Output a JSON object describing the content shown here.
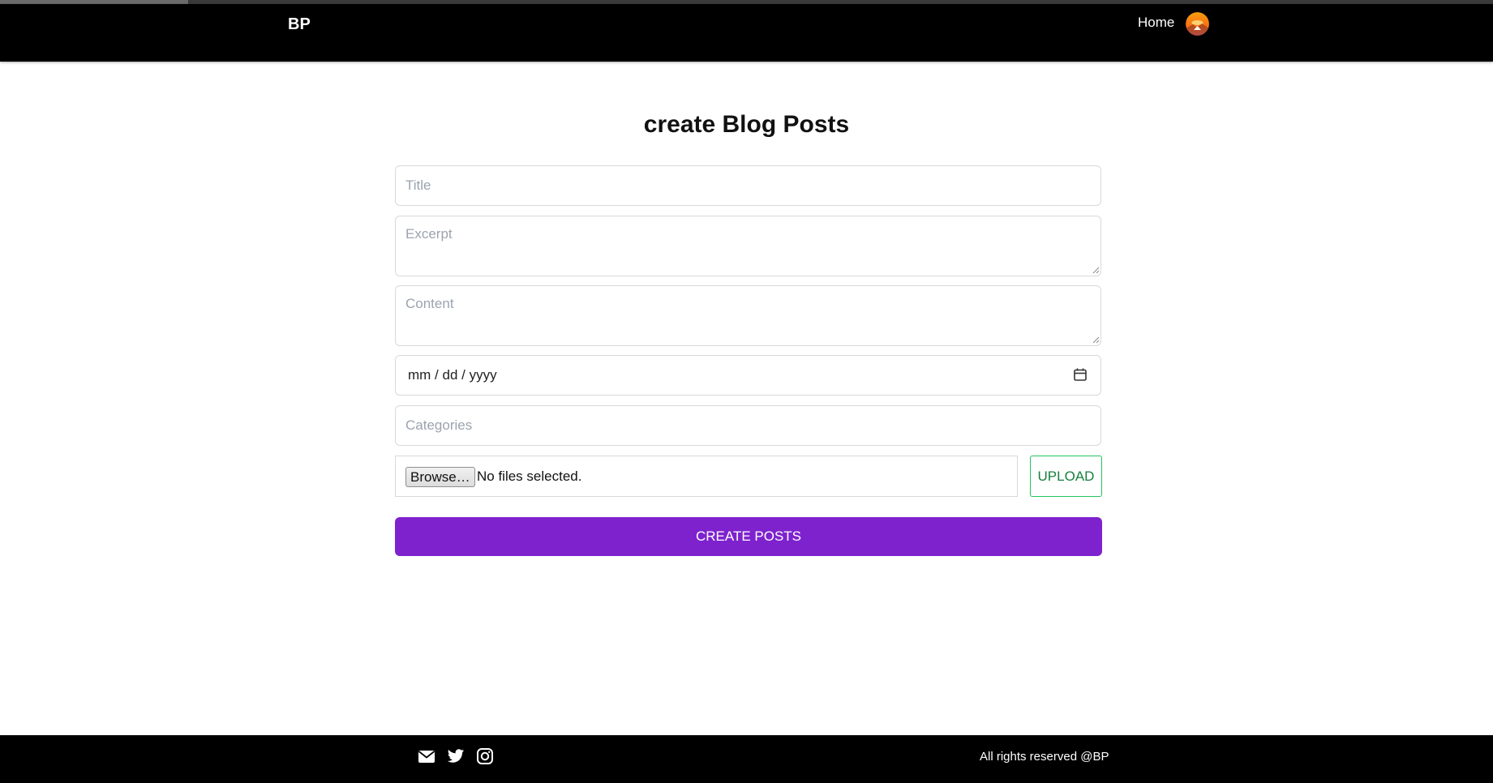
{
  "navbar": {
    "brand": "BP",
    "home_label": "Home",
    "avatar_icon": "avatar-sunset-icon"
  },
  "form": {
    "heading": "create Blog Posts",
    "title_placeholder": "Title",
    "excerpt_placeholder": "Excerpt",
    "content_placeholder": "Content",
    "date_placeholder": "mm / dd / yyyy",
    "categories_placeholder": "Categories",
    "browse_label": "Browse…",
    "file_status": "No files selected.",
    "upload_label": "UPLOAD",
    "submit_label": "CREATE POSTS"
  },
  "footer": {
    "icons": [
      "mail-icon",
      "twitter-icon",
      "instagram-icon"
    ],
    "copyright": "All rights reserved @BP"
  },
  "colors": {
    "header_bg": "#000000",
    "submit_bg": "#7e22ce",
    "upload_border": "#22c55e",
    "upload_text": "#15803d"
  }
}
